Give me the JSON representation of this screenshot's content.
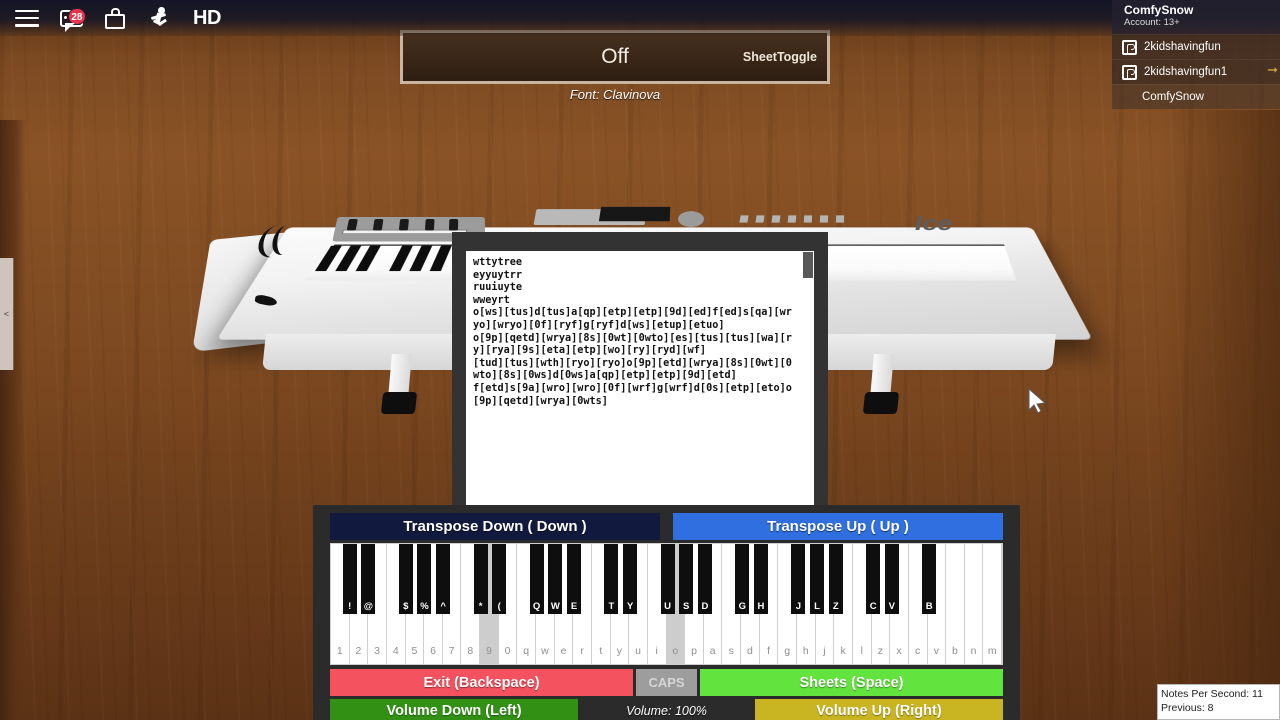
{
  "topbar": {
    "menu_icon": "hamburger-menu-icon",
    "chat_icon": "chat-bubble-icon",
    "chat_badge": "28",
    "inventory_icon": "backpack-icon",
    "emotes_icon": "running-person-icon",
    "quality_label": "HD"
  },
  "player_list": {
    "local_player": "ComfySnow",
    "account_label": "Account: 13+",
    "players": [
      {
        "name": "2kidshavingfun",
        "icon": "roblox-premium-icon"
      },
      {
        "name": "2kidshavingfun1",
        "icon": "roblox-premium-icon"
      },
      {
        "name": "ComfySnow",
        "icon": ""
      }
    ]
  },
  "left_tab": {
    "arrow": "<"
  },
  "sheet_toggle": {
    "state": "Off",
    "label": "SheetToggle",
    "font_line": "Font: Clavinova"
  },
  "keyboard_prop": {
    "brand": "Ice"
  },
  "sheet_panel": {
    "text": "wttytree\neyyuytrr\nruuiuyte\nwweyrt\no[ws][tus]d[tus]a[qp][etp][etp][9d][ed]f[ed]s[qa][wryo][wryo][0f][ryf]g[ryf]d[ws][etup][etuo]\no[9p][qetd][wrya][8s][0wt][0wto][es][tus][tus][wa][ry][rya][9s][eta][etp][wo][ry][ryd][wf]\n[tud][tus][wth][ryo][ryo]o[9p][etd][wrya][8s][0wt][0wto][8s][0ws]d[0ws]a[qp][etp][etp][9d][etd]\nf[etd]s[9a][wro][wro][0f][wrf]g[wrf]d[0s][etp][eto]o[9p][qetd][wrya][0wts]",
    "scroll_position": "top"
  },
  "piano_gui": {
    "transpose_down_label": "Transpose Down ( Down )",
    "transpose_up_label": "Transpose Up (  Up  )",
    "exit_label": "Exit (Backspace)",
    "caps_label": "CAPS",
    "sheets_label": "Sheets (Space)",
    "volume_down_label": "Volume Down (Left)",
    "volume_text": "Volume: 100%",
    "volume_up_label": "Volume Up (Right)",
    "white_keys": [
      "1",
      "2",
      "3",
      "4",
      "5",
      "6",
      "7",
      "8",
      "9",
      "0",
      "q",
      "w",
      "e",
      "r",
      "t",
      "y",
      "u",
      "i",
      "o",
      "p",
      "a",
      "s",
      "d",
      "f",
      "g",
      "h",
      "j",
      "k",
      "l",
      "z",
      "x",
      "c",
      "v",
      "b",
      "n",
      "m"
    ],
    "active_white_keys": [
      "9",
      "o"
    ],
    "black_keys": [
      "!",
      "@",
      "$",
      "%",
      "^",
      "*",
      "(",
      "Q",
      "W",
      "E",
      "T",
      "Y",
      "U",
      "S",
      "D",
      "G",
      "H",
      "J",
      "L",
      "Z",
      "C",
      "V",
      "B"
    ]
  },
  "colors": {
    "transpose_down": "#111a3e",
    "transpose_up": "#2f6fe0",
    "exit": "#f5525f",
    "sheets": "#63e33e",
    "volume_down": "#329115",
    "volume_up": "#c9b522",
    "caps": "#9d9d9d",
    "badge": "#e8344a"
  },
  "nps": {
    "current": "Notes Per Second: 11",
    "previous": "Previous: 8"
  }
}
